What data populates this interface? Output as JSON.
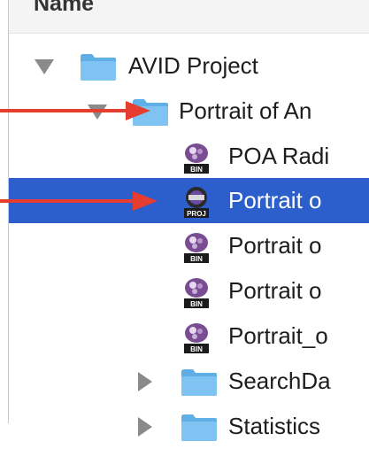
{
  "header": {
    "column_name": "Name"
  },
  "rows": [
    {
      "label": "AVID Project",
      "kind": "folder",
      "expanded": true
    },
    {
      "label": "Portrait of An",
      "kind": "folder",
      "expanded": true
    },
    {
      "label": "POA Radi",
      "kind": "bin-file",
      "icon": "bin-icon",
      "badge": "BIN"
    },
    {
      "label": "Portrait o",
      "kind": "project-file",
      "icon": "proj-icon",
      "badge": "PROJ",
      "selected": true
    },
    {
      "label": "Portrait o",
      "kind": "bin-file",
      "icon": "bin-icon",
      "badge": "BIN"
    },
    {
      "label": "Portrait o",
      "kind": "bin-file",
      "icon": "bin-icon",
      "badge": "BIN"
    },
    {
      "label": "Portrait_o",
      "kind": "bin-file",
      "icon": "bin-icon",
      "badge": "BIN"
    },
    {
      "label": "SearchDa",
      "kind": "folder",
      "expanded": false
    },
    {
      "label": "Statistics",
      "kind": "folder",
      "expanded": false
    }
  ],
  "colors": {
    "selection": "#2c5fcc",
    "folder": "#7ec3f2",
    "annotation_arrow": "#e53d2f",
    "bin_purple": "#5a2d6e"
  }
}
